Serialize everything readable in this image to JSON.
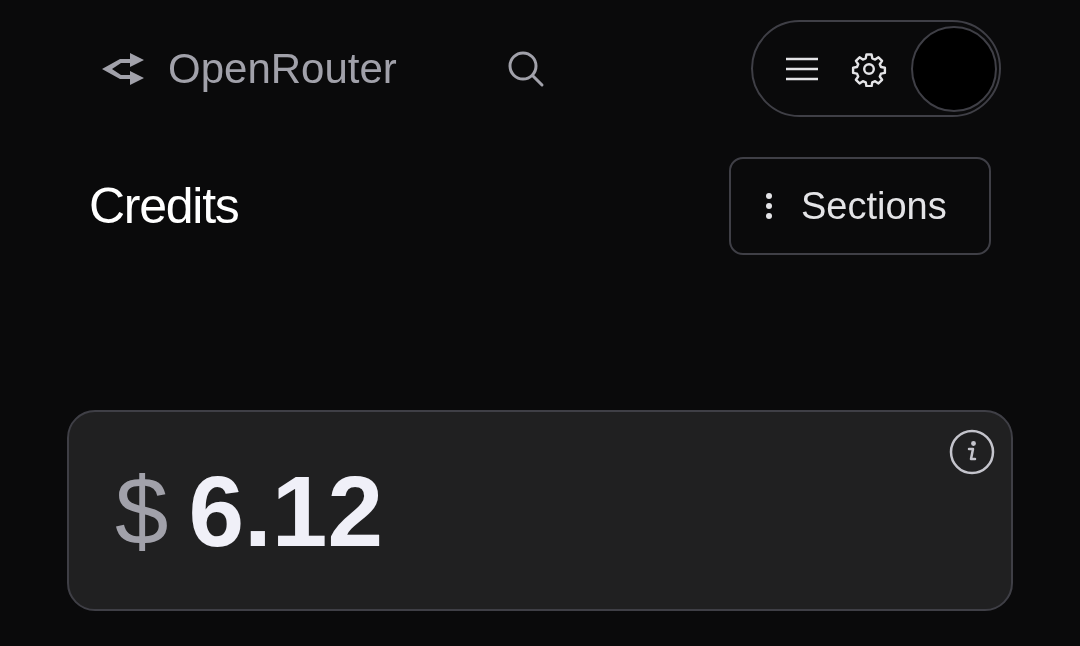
{
  "header": {
    "brand": "OpenRouter"
  },
  "page": {
    "title": "Credits",
    "sections_button": "Sections"
  },
  "balance": {
    "currency": "$",
    "amount": "6.12"
  }
}
